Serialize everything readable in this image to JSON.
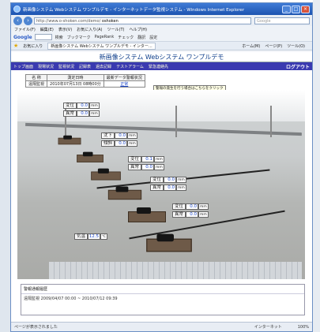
{
  "window": {
    "title": "新画像システム Webシステム ワンプルデモ - インターネットデータ監視システム - Windows Internet Explorer",
    "address": "http://www.o-shoken.com/demo/",
    "address_host": "oshoken",
    "search_placeholder": "Google",
    "menu": [
      "ファイル(F)",
      "編集(E)",
      "表示(V)",
      "お気に入り(A)",
      "ツール(T)",
      "ヘルプ(H)"
    ],
    "toolbar_google": "Google",
    "toolbar_items": [
      "検索",
      "ブックマーク",
      "PageRank",
      "チェック",
      "翻訳",
      "設定"
    ],
    "favorites_label": "お気に入り",
    "tab_label": "新画像システム Webシステム ワンプルデモ - インター...",
    "fav_right": [
      "ホーム(M)",
      "ページ(P)",
      "ツール(O)"
    ],
    "status_left": "ページが表示されました",
    "status_mid": "インターネット",
    "status_zoom": "100%"
  },
  "app": {
    "title": "新画像システム Webシステム ワンプルデモ",
    "nav": [
      "トップ画面",
      "現場状況",
      "監視状況",
      "記録表",
      "過去記録",
      "テストアラーム",
      "緊急連絡先"
    ],
    "logout": "ログアウト"
  },
  "status_table": {
    "headers": [
      "名 称",
      "測定日時",
      "最新データ警報状況"
    ],
    "row": [
      "遠隔監視",
      "2010年07月13日 08時00分",
      "正常"
    ],
    "tooltip": "警報の発生を行う場合はこちらをクリック"
  },
  "readings": [
    {
      "label": "変位",
      "value": "0.0",
      "unit": "mm"
    },
    {
      "label": "異常",
      "value": "0.0",
      "unit": "mm"
    },
    {
      "label": "沈下",
      "value": "0.0",
      "unit": "mm"
    },
    {
      "label": "傾斜",
      "value": "0.0",
      "unit": "mm"
    },
    {
      "label": "変位",
      "value": "0.1",
      "unit": "mm"
    },
    {
      "label": "異常",
      "value": "0.0",
      "unit": "mm"
    },
    {
      "label": "変位",
      "value": "0.0",
      "unit": "mm"
    },
    {
      "label": "異常",
      "value": "0.0",
      "unit": "mm"
    },
    {
      "label": "変位",
      "value": "0.0",
      "unit": "mm"
    },
    {
      "label": "異常",
      "value": "0.0",
      "unit": "mm"
    },
    {
      "label": "気温",
      "value": "12.5",
      "unit": "℃"
    }
  ],
  "log": {
    "header": "警報通報履歴",
    "row": "遠隔監視 2009/04/07 00:00 ~ 2010/07/12 09:39"
  }
}
